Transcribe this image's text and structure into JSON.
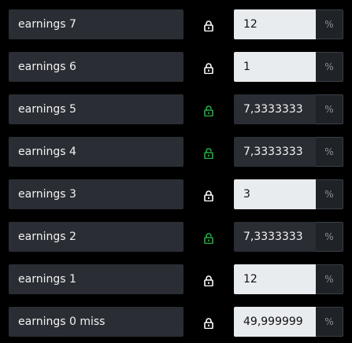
{
  "colors": {
    "locked_icon": "#ffffff",
    "unlocked_icon": "#1fb141",
    "locked_value_bg": "#e9ecef",
    "unlocked_value_bg": "#2a2e34",
    "label_bg": "#2a2e34",
    "page_bg": "#000000"
  },
  "rows": [
    {
      "label": "earnings 7",
      "value": "12",
      "unit": "%",
      "locked": true,
      "icon": "lock-closed-icon"
    },
    {
      "label": "earnings 6",
      "value": "1",
      "unit": "%",
      "locked": true,
      "icon": "lock-closed-icon"
    },
    {
      "label": "earnings 5",
      "value": "7,3333333",
      "unit": "%",
      "locked": false,
      "icon": "lock-open-icon"
    },
    {
      "label": "earnings 4",
      "value": "7,3333333",
      "unit": "%",
      "locked": false,
      "icon": "lock-open-icon"
    },
    {
      "label": "earnings 3",
      "value": "3",
      "unit": "%",
      "locked": true,
      "icon": "lock-closed-icon"
    },
    {
      "label": "earnings 2",
      "value": "7,3333333",
      "unit": "%",
      "locked": false,
      "icon": "lock-open-icon"
    },
    {
      "label": "earnings 1",
      "value": "12",
      "unit": "%",
      "locked": true,
      "icon": "lock-closed-icon"
    },
    {
      "label": "earnings 0 miss",
      "value": "49,999999",
      "unit": "%",
      "locked": true,
      "icon": "lock-closed-icon"
    }
  ]
}
